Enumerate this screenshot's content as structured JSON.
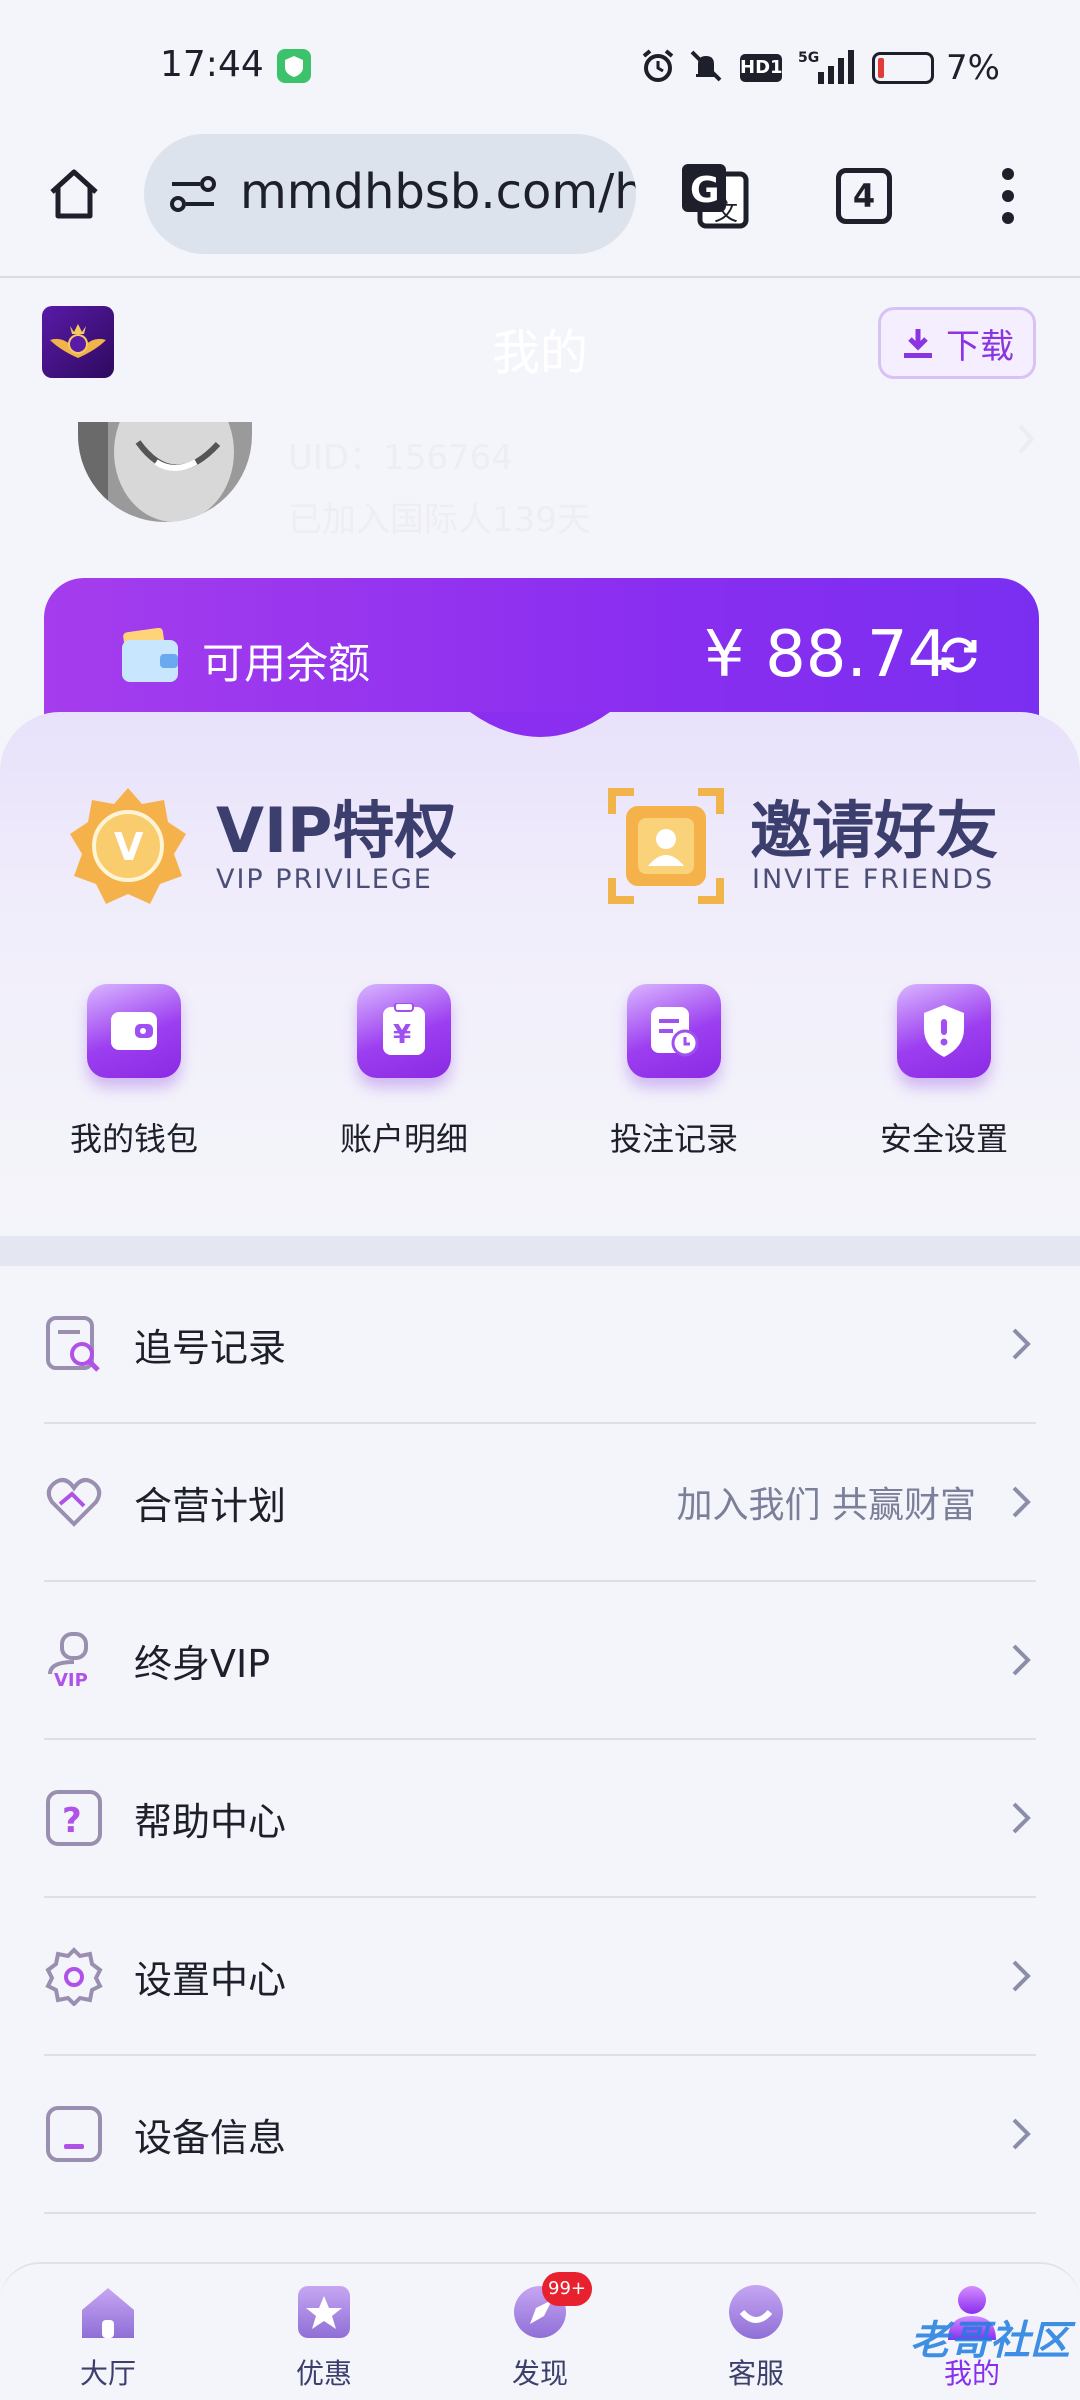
{
  "status_bar": {
    "time": "17:44",
    "battery": "7%",
    "network": "5G",
    "hd": "HD1"
  },
  "browser": {
    "url": "mmdhbsb.com/hc",
    "tab_count": "4"
  },
  "header": {
    "title": "我的",
    "download_label": "下载",
    "uid": "UID：156764",
    "joined": "已加入国际人139天"
  },
  "balance": {
    "label": "可用余额",
    "amount": "¥ 88.74"
  },
  "features": [
    {
      "title": "VIP特权",
      "subtitle": "VIP PRIVILEGE"
    },
    {
      "title": "邀请好友",
      "subtitle": "INVITE FRIENDS"
    }
  ],
  "quick_actions": [
    {
      "label": "我的钱包",
      "icon": "wallet-icon"
    },
    {
      "label": "账户明细",
      "icon": "bill-icon"
    },
    {
      "label": "投注记录",
      "icon": "record-icon"
    },
    {
      "label": "安全设置",
      "icon": "shield-icon"
    }
  ],
  "menu": [
    {
      "label": "追号记录",
      "hint": "",
      "icon": "search-record-icon"
    },
    {
      "label": "合营计划",
      "hint": "加入我们 共赢财富",
      "icon": "handshake-heart-icon"
    },
    {
      "label": "终身VIP",
      "hint": "",
      "icon": "vip-user-icon"
    },
    {
      "label": "帮助中心",
      "hint": "",
      "icon": "help-icon"
    },
    {
      "label": "设置中心",
      "hint": "",
      "icon": "gear-icon"
    },
    {
      "label": "设备信息",
      "hint": "",
      "icon": "device-icon"
    }
  ],
  "bottom_nav": [
    {
      "label": "大厅",
      "icon": "home-icon"
    },
    {
      "label": "优惠",
      "icon": "star-icon"
    },
    {
      "label": "发现",
      "icon": "discover-icon",
      "badge": "99+"
    },
    {
      "label": "客服",
      "icon": "service-icon"
    },
    {
      "label": "我的",
      "icon": "profile-icon"
    }
  ],
  "watermark": "老哥社区",
  "colors": {
    "accent": "#8a2ef0",
    "text": "#1d1f2a",
    "muted": "#7b7f9a",
    "nav_text": "#3c3f6d"
  }
}
